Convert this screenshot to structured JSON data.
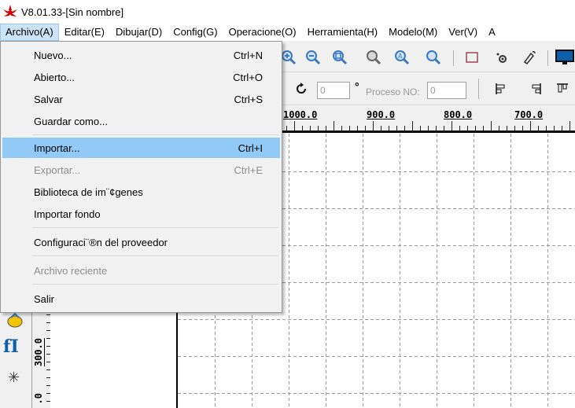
{
  "window": {
    "title": "V8.01.33-[Sin nombre]",
    "logo_icon": "laser-logo-icon",
    "accent": "#cc0000"
  },
  "menubar": {
    "items": [
      {
        "label": "Archivo(A)",
        "open": true
      },
      {
        "label": "Editar(E)"
      },
      {
        "label": "Dibujar(D)"
      },
      {
        "label": "Config(G)"
      },
      {
        "label": "Operacione(O)"
      },
      {
        "label": "Herramienta(H)"
      },
      {
        "label": "Modelo(M)"
      },
      {
        "label": "Ver(V)"
      },
      {
        "label": "A"
      }
    ]
  },
  "file_menu": {
    "items": [
      {
        "label": "Nuevo...",
        "shortcut": "Ctrl+N"
      },
      {
        "label": "Abierto...",
        "shortcut": "Ctrl+O"
      },
      {
        "label": "Salvar",
        "shortcut": "Ctrl+S"
      },
      {
        "label": "Guardar como...",
        "shortcut": ""
      },
      {
        "label": "Importar...",
        "shortcut": "Ctrl+I",
        "highlighted": true
      },
      {
        "label": "Exportar...",
        "shortcut": "Ctrl+E",
        "disabled": true
      },
      {
        "label": "Biblioteca de im¨¢genes",
        "shortcut": ""
      },
      {
        "label": "Importar fondo",
        "shortcut": ""
      },
      {
        "label": "Configuraci¨®n del proveedor",
        "shortcut": ""
      },
      {
        "label": "Archivo reciente",
        "shortcut": "",
        "disabled": true
      },
      {
        "label": "Salir",
        "shortcut": ""
      }
    ]
  },
  "toolbar": {
    "icons": [
      "zoom-in-icon",
      "zoom-out-icon",
      "zoom-page-icon",
      "zoom-fit-icon",
      "zoom-select-icon",
      "zoom-icon",
      "rectangle-select-icon",
      "camera-icon",
      "pen-icon",
      "monitor-icon"
    ],
    "angle_value": "0",
    "degree_symbol": "°",
    "proceso_label": "Proceso NO:",
    "proceso_value": "0",
    "row2_icons": [
      "rotate-icon",
      "align-icon-1",
      "align-icon-2",
      "align-icon-3"
    ]
  },
  "ruler": {
    "h_labels": [
      "1000.0",
      "900.0",
      "800.0",
      "700.0"
    ],
    "v_labels": [
      "300.0",
      ".0"
    ]
  },
  "left_tools": {
    "icons": [
      "shape-tool-icon",
      "text-tool-icon",
      "star-tool-icon"
    ],
    "text_tool_glyph": "fI",
    "star_glyph": "✳"
  },
  "colors": {
    "menu_highlight": "#91c9f7",
    "menubar_open": "#cce4f7",
    "icon_blue": "#3a78c2",
    "icon_red": "#cc2a2a"
  }
}
